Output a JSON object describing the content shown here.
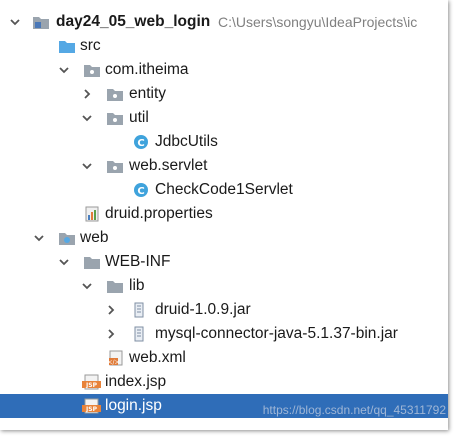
{
  "project": {
    "name": "day24_05_web_login",
    "path": "C:\\Users\\songyu\\IdeaProjects\\ic"
  },
  "tree": {
    "src": "src",
    "package": "com.itheima",
    "entity": "entity",
    "util": "util",
    "jdbc_utils": "JdbcUtils",
    "web_servlet": "web.servlet",
    "checkcode_servlet": "CheckCode1Servlet",
    "druid_properties": "druid.properties",
    "web": "web",
    "web_inf": "WEB-INF",
    "lib": "lib",
    "druid_jar": "druid-1.0.9.jar",
    "mysql_jar": "mysql-connector-java-5.1.37-bin.jar",
    "web_xml": "web.xml",
    "index_jsp": "index.jsp",
    "login_jsp": "login.jsp"
  },
  "watermark": "https://blog.csdn.net/qq_45311792",
  "colors": {
    "selection": "#2f6db8",
    "folder": "#9aa4ae",
    "source_folder": "#55a8e4",
    "class_icon": "#3fa3dc",
    "jsp_icon": "#e8833a"
  }
}
